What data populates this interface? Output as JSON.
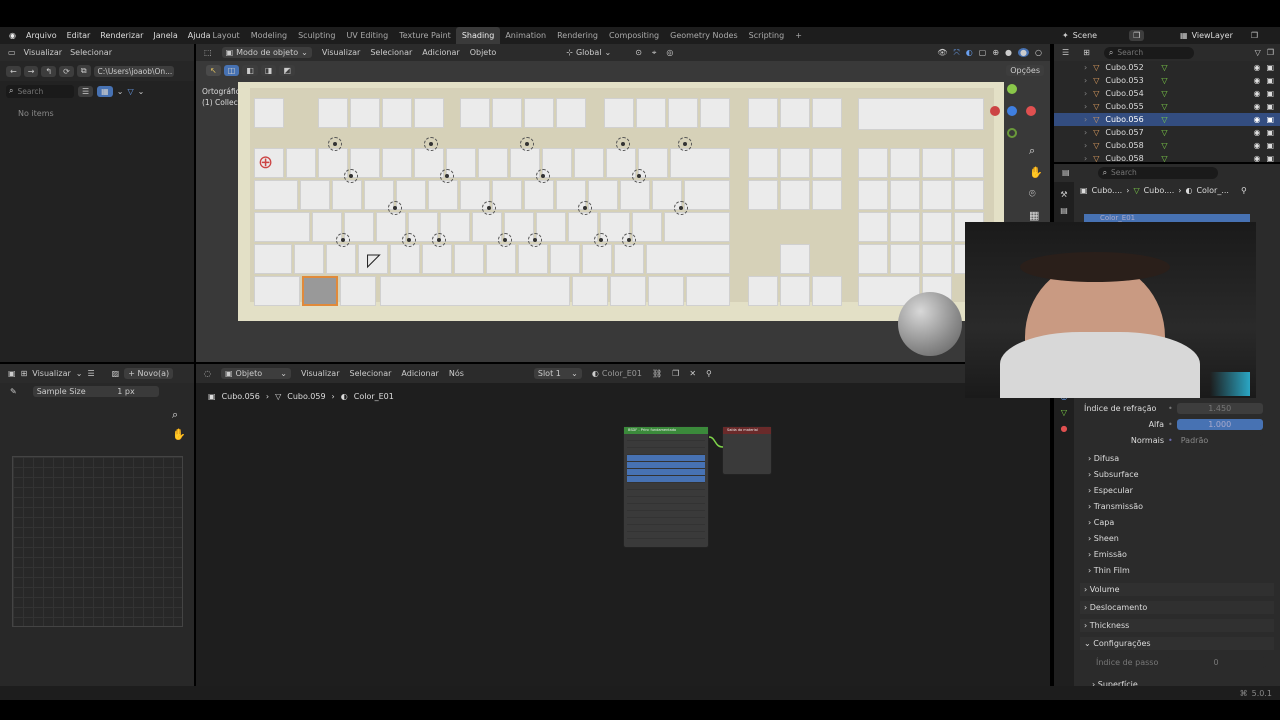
{
  "topbar": {
    "menu": [
      "Arquivo",
      "Editar",
      "Renderizar",
      "Janela",
      "Ajuda"
    ],
    "tabs": [
      "Layout",
      "Modeling",
      "Sculpting",
      "UV Editing",
      "Texture Paint",
      "Shading",
      "Animation",
      "Rendering",
      "Compositing",
      "Geometry Nodes",
      "Scripting"
    ],
    "active_tab": "Shading",
    "add_tab": "+",
    "scene": "Scene",
    "view_layer": "ViewLayer"
  },
  "file_browser": {
    "menu": [
      "Visualizar",
      "Selecionar"
    ],
    "path": "C:\\Users\\joaob\\On...",
    "search_placeholder": "Search",
    "empty_text": "No items"
  },
  "viewport": {
    "mode": "Modo de objeto",
    "menu": [
      "Visualizar",
      "Selecionar",
      "Adicionar",
      "Objeto"
    ],
    "transform": "Global",
    "view_name": "Ortográfica do Topo",
    "collection": "(1) Collection | Cubo.056",
    "options": "Opções"
  },
  "image_editor": {
    "menu": "Visualizar",
    "new_button": "Novo(a)",
    "sample_size_label": "Sample Size",
    "sample_size_value": "1 px"
  },
  "node_editor": {
    "object_mode": "Objeto",
    "menu": [
      "Visualizar",
      "Selecionar",
      "Adicionar",
      "Nós"
    ],
    "slot": "Slot 1",
    "material": "Color_E01",
    "breadcrumb": [
      "Cubo.056",
      "Cubo.059",
      "Color_E01"
    ],
    "bsdf_title": "BSDF - Princ fundamentado",
    "output_title": "Saída do material"
  },
  "outliner": {
    "search_placeholder": "Search",
    "items": [
      "Cubo.052",
      "Cubo.053",
      "Cubo.054",
      "Cubo.055",
      "Cubo.056",
      "Cubo.057",
      "Cubo.058",
      "Cubo.058"
    ],
    "selected_index": 4
  },
  "properties": {
    "search_placeholder": "Search",
    "breadcrumb": [
      "Cubo....",
      "Cubo....",
      "Color_..."
    ],
    "material_slot": "Color_E01",
    "ior_label": "Índice de refração",
    "ior_value": "1.450",
    "alpha_label": "Alfa",
    "alpha_value": "1.000",
    "normals_label": "Normais",
    "normals_value": "Padrão",
    "sections": [
      "Difusa",
      "Subsurface",
      "Especular",
      "Transmissão",
      "Capa",
      "Sheen",
      "Emissão",
      "Thin Film"
    ],
    "groups": [
      "Volume",
      "Deslocamento",
      "Thickness",
      "Configurações"
    ],
    "step_label": "Índice de passo",
    "step_value": "0",
    "last_section": "Superfície"
  },
  "status": {
    "version": "5.0.1"
  },
  "colors": {
    "accent": "#4772b3",
    "selected_object": "#e08a3a",
    "node_green": "#3b8a3b"
  }
}
